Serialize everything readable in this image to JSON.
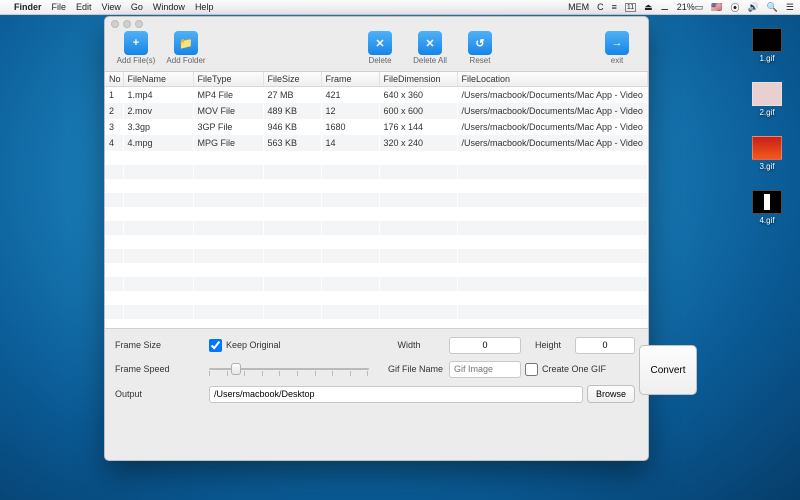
{
  "menubar": {
    "app": "Finder",
    "items": [
      "File",
      "Edit",
      "View",
      "Go",
      "Window",
      "Help"
    ],
    "status": {
      "mem": "MEM",
      "date": "11",
      "battery": "21%"
    }
  },
  "desktop": [
    {
      "label": "1.gif"
    },
    {
      "label": "2.gif"
    },
    {
      "label": "3.gif"
    },
    {
      "label": "4.gif"
    }
  ],
  "toolbar": {
    "add_files": "Add File(s)",
    "add_folder": "Add Folder",
    "delete": "Delete",
    "delete_all": "Delete All",
    "reset": "Reset",
    "exit": "exit"
  },
  "table": {
    "headers": {
      "no": "No",
      "fn": "FileName",
      "ft": "FileType",
      "fs": "FileSize",
      "fr": "Frame",
      "fd": "FileDimension",
      "fl": "FileLocation"
    },
    "rows": [
      {
        "no": "1",
        "fn": "1.mp4",
        "ft": "MP4 File",
        "fs": "27 MB",
        "fr": "421",
        "fd": "640 x 360",
        "fl": "/Users/macbook/Documents/Mac App - Video"
      },
      {
        "no": "2",
        "fn": "2.mov",
        "ft": "MOV File",
        "fs": "489 KB",
        "fr": "12",
        "fd": "600 x 600",
        "fl": "/Users/macbook/Documents/Mac App - Video"
      },
      {
        "no": "3",
        "fn": "3.3gp",
        "ft": "3GP File",
        "fs": "946 KB",
        "fr": "1680",
        "fd": "176 x 144",
        "fl": "/Users/macbook/Documents/Mac App - Video"
      },
      {
        "no": "4",
        "fn": "4.mpg",
        "ft": "MPG File",
        "fs": "563 KB",
        "fr": "14",
        "fd": "320 x 240",
        "fl": "/Users/macbook/Documents/Mac App - Video"
      }
    ]
  },
  "opts": {
    "frame_size_label": "Frame Size",
    "keep_original_label": "Keep Original",
    "width_label": "Width",
    "width_value": "0",
    "height_label": "Height",
    "height_value": "0",
    "frame_speed_label": "Frame Speed",
    "gif_name_label": "Gif File Name",
    "gif_name_placeholder": "Gif Image",
    "create_one_label": "Create One GIF",
    "output_label": "Output",
    "output_value": "/Users/macbook/Desktop",
    "browse_label": "Browse",
    "convert_label": "Convert"
  }
}
